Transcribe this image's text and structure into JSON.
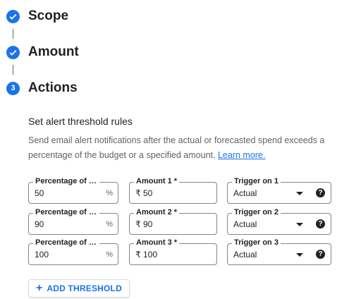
{
  "steps": [
    {
      "title": "Scope",
      "status": "done"
    },
    {
      "title": "Amount",
      "status": "done"
    },
    {
      "title": "Actions",
      "number": "3"
    }
  ],
  "section": {
    "title": "Set alert threshold rules",
    "description": "Send email alert notifications after the actual or forecasted spend exceeds a percentage of the budget or a specified amount.",
    "learn_more": "Learn more."
  },
  "thresholds": [
    {
      "pct_label": "Percentage of bu...",
      "pct_value": "50",
      "pct_suffix": "%",
      "amount_label": "Amount 1 *",
      "amount_value": "₹ 50",
      "trigger_label": "Trigger on 1",
      "trigger_value": "Actual"
    },
    {
      "pct_label": "Percentage of bu...",
      "pct_value": "90",
      "pct_suffix": "%",
      "amount_label": "Amount 2 *",
      "amount_value": "₹ 90",
      "trigger_label": "Trigger on 2",
      "trigger_value": "Actual"
    },
    {
      "pct_label": "Percentage of bu...",
      "pct_value": "100",
      "pct_suffix": "%",
      "amount_label": "Amount 3 *",
      "amount_value": "₹ 100",
      "trigger_label": "Trigger on 3",
      "trigger_value": "Actual"
    }
  ],
  "add_threshold_label": "ADD THRESHOLD",
  "colors": {
    "accent": "#1a73e8",
    "text": "#202124",
    "secondary": "#5f6368"
  },
  "icons": {
    "done": "check-icon",
    "help": "help-icon",
    "add": "plus-icon",
    "dropdown": "caret-down-icon"
  }
}
